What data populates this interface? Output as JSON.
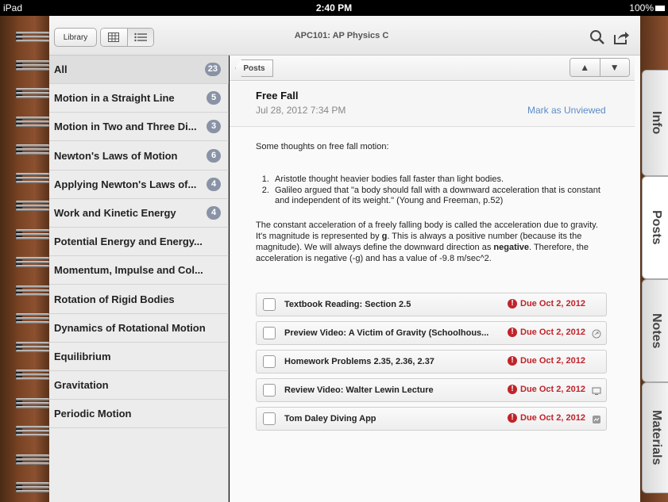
{
  "status_bar": {
    "device": "iPad",
    "time": "2:40 PM",
    "battery": "100%"
  },
  "header": {
    "library_label": "Library",
    "title": "APC101: AP Physics C",
    "icons": [
      "grid-view-icon",
      "list-view-icon",
      "search-icon",
      "share-icon"
    ]
  },
  "sidebar": {
    "items": [
      {
        "label": "All",
        "count": "23"
      },
      {
        "label": "Motion in a Straight Line",
        "count": "5"
      },
      {
        "label": "Motion in Two and Three Di...",
        "count": "3"
      },
      {
        "label": "Newton's Laws of Motion",
        "count": "6"
      },
      {
        "label": "Applying Newton's Laws of...",
        "count": "4"
      },
      {
        "label": "Work and Kinetic Energy",
        "count": "4"
      },
      {
        "label": "Potential Energy and Energy...",
        "count": ""
      },
      {
        "label": "Momentum, Impulse and Col...",
        "count": ""
      },
      {
        "label": "Rotation of Rigid Bodies",
        "count": ""
      },
      {
        "label": "Dynamics of Rotational Motion",
        "count": ""
      },
      {
        "label": "Equilibrium",
        "count": ""
      },
      {
        "label": "Gravitation",
        "count": ""
      },
      {
        "label": "Periodic Motion",
        "count": ""
      }
    ]
  },
  "subbar": {
    "back_label": "Posts",
    "up_arrow": "▲",
    "down_arrow": "▼"
  },
  "post": {
    "title": "Free Fall",
    "date": "Jul 28, 2012 7:34 PM",
    "mark_label": "Mark as Unviewed",
    "intro": "Some thoughts on free fall motion:",
    "points": [
      "Aristotle thought heavier bodies fall faster than light bodies.",
      "Galileo argued that \"a body should fall with a downward acceleration that is constant and independent of its weight.\" (Young and Freeman, p.52)"
    ],
    "para_part1": "The constant acceleration of a freely falling body is called the acceleration due to gravity. It's magnitude is represented by ",
    "para_bold1": "g",
    "para_part2": ".  This is always a positive number (because its the magnitude).  We will always define the downward direction as ",
    "para_bold2": "negative",
    "para_part3": ".  Therefore, the acceleration is negative (-g) and has a value of -9.8 m/sec^2."
  },
  "tasks": [
    {
      "label": "Textbook Reading: Section 2.5",
      "due": "Due Oct 2, 2012",
      "icon": ""
    },
    {
      "label": "Preview Video: A Victim of Gravity (Schoolhous...",
      "due": "Due Oct 2, 2012",
      "icon": "link-icon"
    },
    {
      "label": "Homework Problems 2.35, 2.36, 2.37",
      "due": "Due Oct 2, 2012",
      "icon": ""
    },
    {
      "label": "Review Video: Walter Lewin Lecture",
      "due": "Due Oct 2, 2012",
      "icon": "monitor-icon"
    },
    {
      "label": "Tom Daley Diving App",
      "due": "Due Oct 2, 2012",
      "icon": "app-icon"
    }
  ],
  "side_tabs": [
    "Info",
    "Posts",
    "Notes",
    "Materials"
  ],
  "colors": {
    "badge": "#8a93a6",
    "due_red": "#c0232a",
    "link_blue": "#5b8dc8"
  }
}
